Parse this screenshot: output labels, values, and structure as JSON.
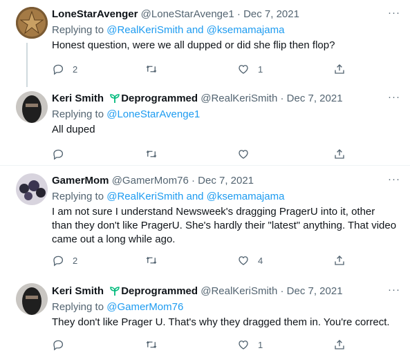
{
  "tweets": [
    {
      "display_name": "LoneStarAvenger",
      "handle": "@LoneStarAvenge1",
      "date": "Dec 7, 2021",
      "replying_to": "Replying to",
      "mentions": "@RealKeriSmith and @ksemamajama",
      "text": "Honest question, were we all dupped or did she flip then flop?",
      "reply_count": "2",
      "retweet_count": "",
      "like_count": "1"
    },
    {
      "display_name": "Keri Smith",
      "name_suffix": "Deprogrammed",
      "handle": "@RealKeriSmith",
      "date": "Dec 7, 2021",
      "replying_to": "Replying to",
      "mentions": "@LoneStarAvenge1",
      "text": "All duped",
      "reply_count": "",
      "retweet_count": "",
      "like_count": ""
    },
    {
      "display_name": "GamerMom",
      "handle": "@GamerMom76",
      "date": "Dec 7, 2021",
      "replying_to": "Replying to",
      "mentions": "@RealKeriSmith and @ksemamajama",
      "text": "I am not sure I understand Newsweek's dragging PragerU into it, other than they don't like PragerU. She's hardly their \"latest\" anything. That video came out a long while ago.",
      "reply_count": "2",
      "retweet_count": "",
      "like_count": "4"
    },
    {
      "display_name": "Keri Smith",
      "name_suffix": "Deprogrammed",
      "handle": "@RealKeriSmith",
      "date": "Dec 7, 2021",
      "replying_to": "Replying to",
      "mentions": "@GamerMom76",
      "text": "They don't like Prager U. That's why they dragged them in. You're correct.",
      "reply_count": "",
      "retweet_count": "",
      "like_count": "1"
    }
  ],
  "ui": {
    "separator": "·",
    "more": "···"
  },
  "colors": {
    "link": "#1d9bf0",
    "secondary_text": "#536471",
    "sprout": "#00ba7c",
    "divider": "#eff3f4"
  }
}
